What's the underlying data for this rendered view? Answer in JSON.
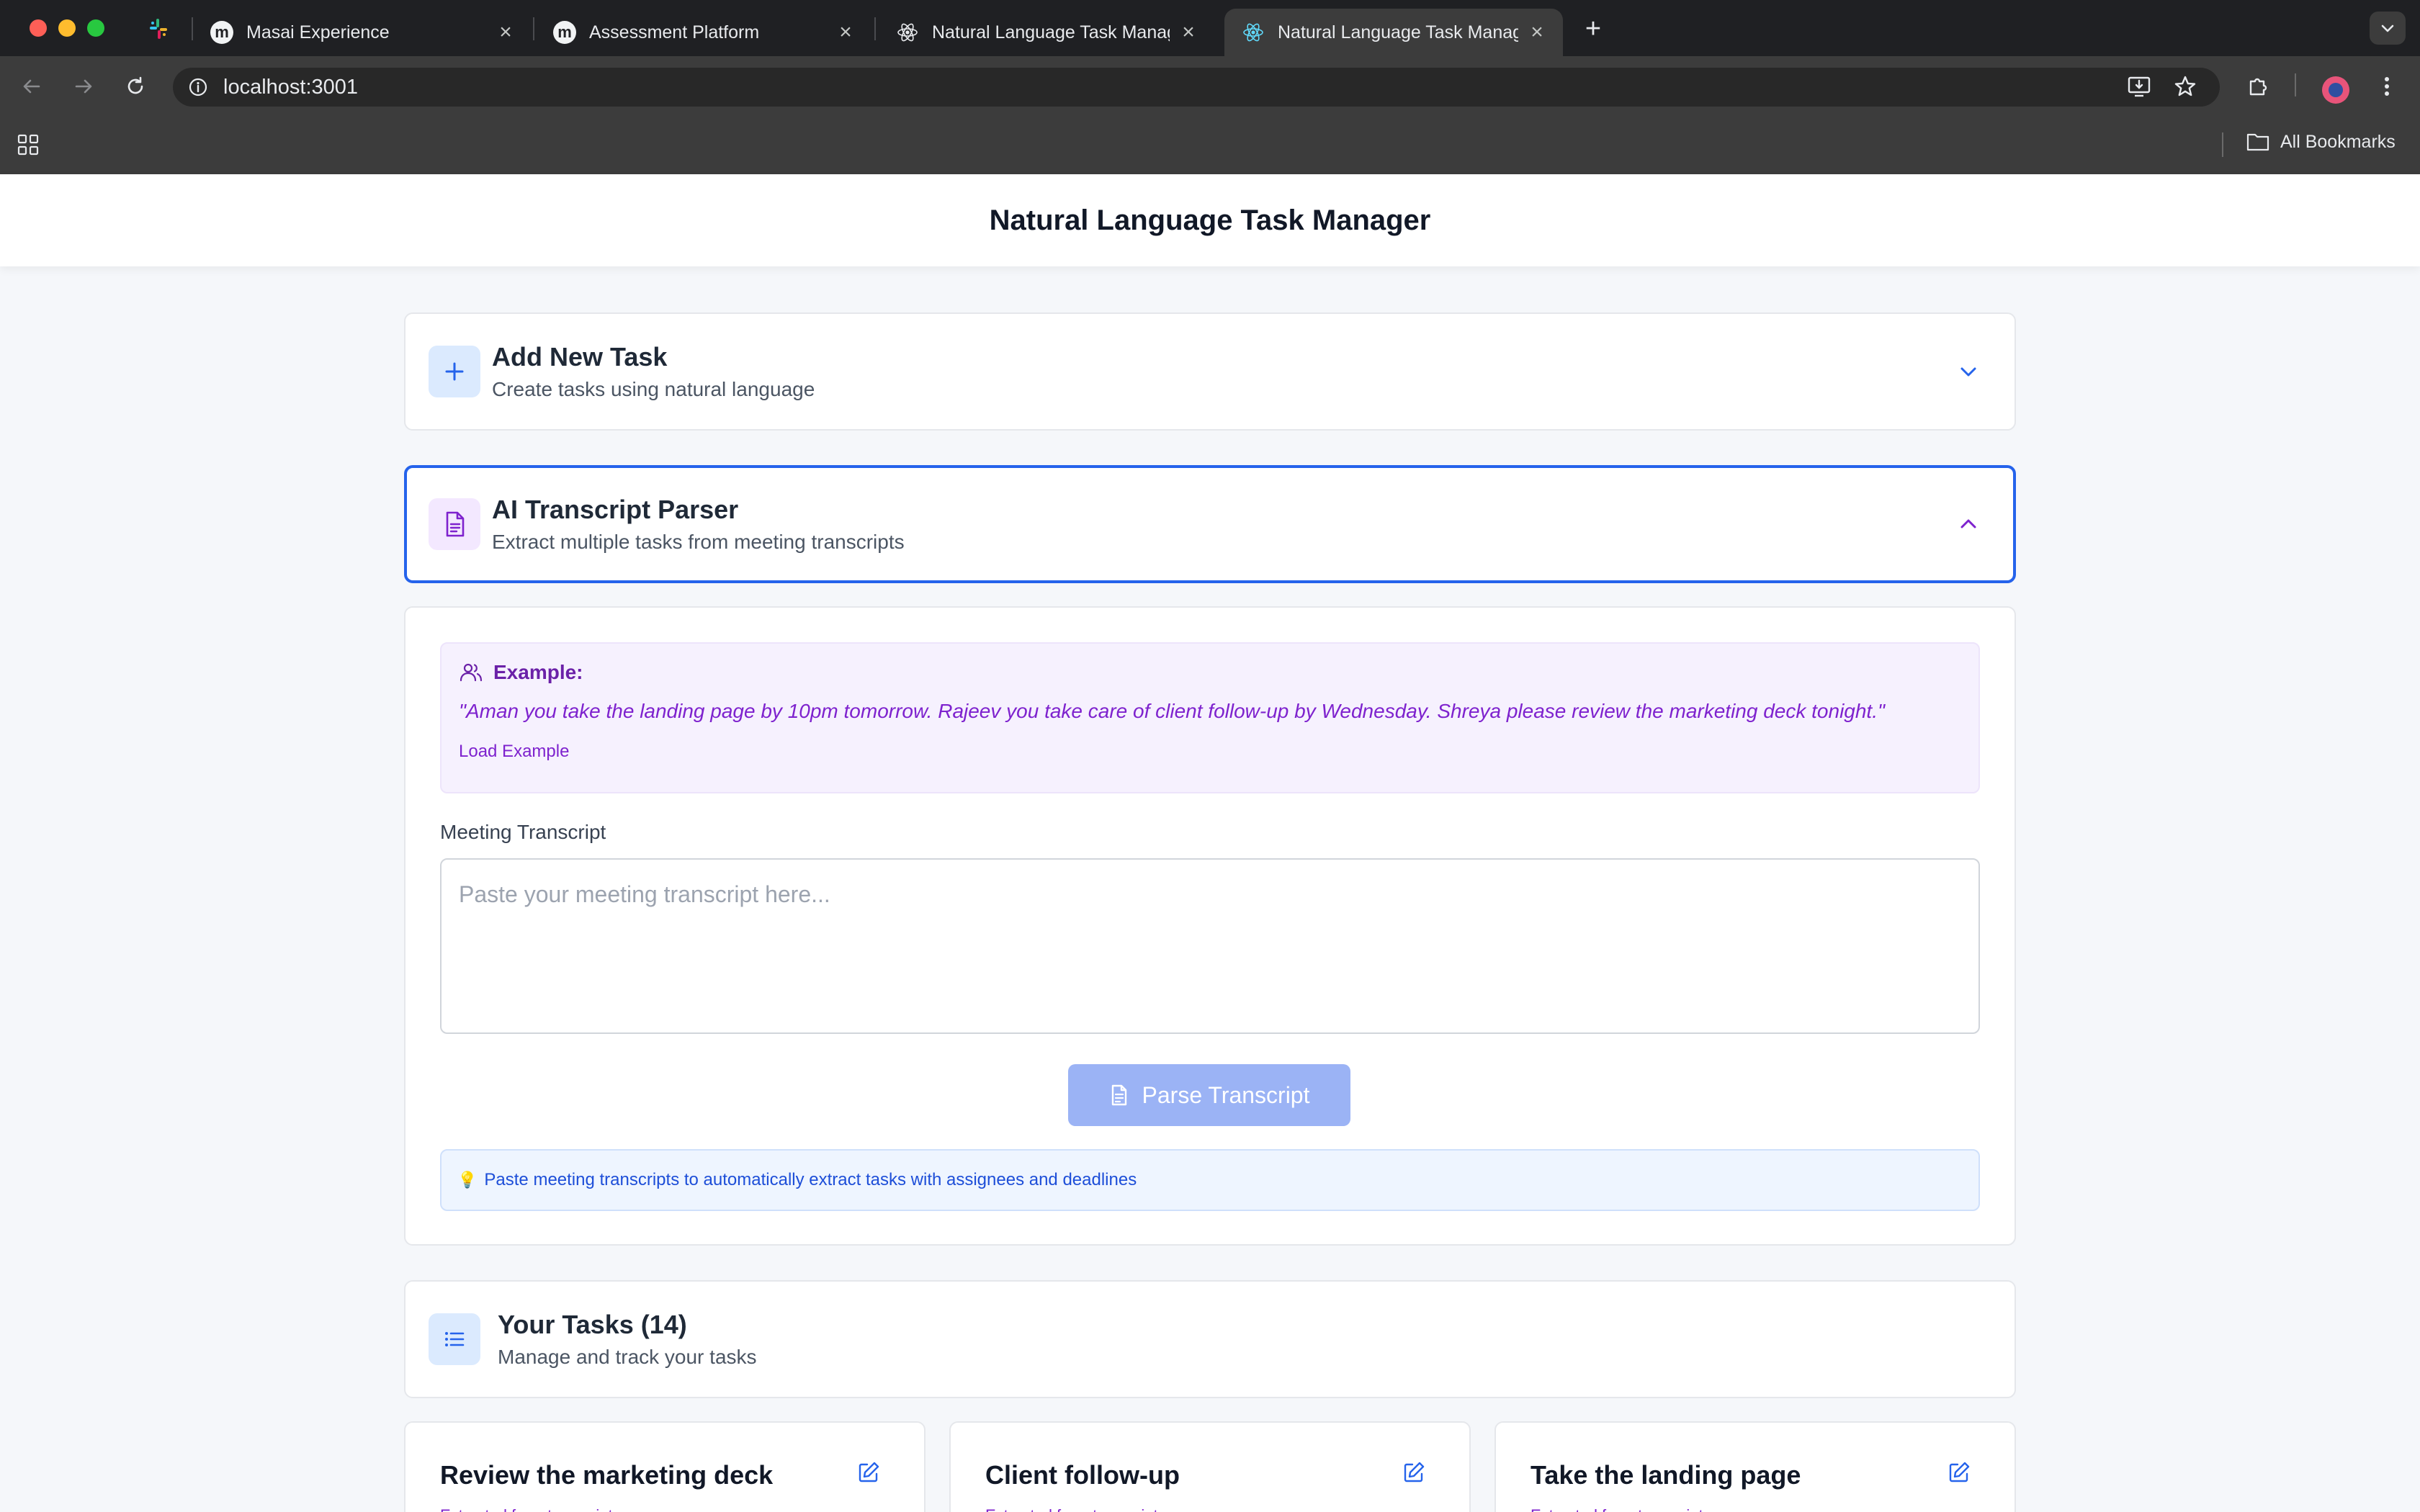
{
  "browser": {
    "tabs": [
      {
        "label": "Masai Experience",
        "icon": "masai-icon"
      },
      {
        "label": "Assessment Platform",
        "icon": "masai-icon"
      },
      {
        "label": "Natural Language Task Manag",
        "icon": "react-icon"
      },
      {
        "label": "Natural Language Task Manag",
        "icon": "react-icon",
        "active": true
      }
    ],
    "favicon_letter": "m",
    "url": "localhost:3001",
    "bookmarks_label": "All Bookmarks"
  },
  "app": {
    "title": "Natural Language Task Manager"
  },
  "add_task": {
    "title": "Add New Task",
    "subtitle": "Create tasks using natural language"
  },
  "parser": {
    "title": "AI Transcript Parser",
    "subtitle": "Extract multiple tasks from meeting transcripts",
    "example_label": "Example:",
    "example_text": "\"Aman you take the landing page by 10pm tomorrow. Rajeev you take care of client follow-up by Wednesday. Shreya please review the marketing deck tonight.\"",
    "load_example": "Load Example",
    "field_label": "Meeting Transcript",
    "placeholder": "Paste your meeting transcript here...",
    "parse_button": "Parse Transcript",
    "tip": "Paste meeting transcripts to automatically extract tasks with assignees and deadlines",
    "tip_icon": "💡"
  },
  "tasks": {
    "title": "Your Tasks (14)",
    "subtitle": "Manage and track your tasks",
    "items": [
      {
        "title": "Review the marketing deck",
        "meta": "Extracted from transcript"
      },
      {
        "title": "Client follow-up",
        "meta": "Extracted from transcript"
      },
      {
        "title": "Take the landing page",
        "meta": "Extracted from transcript"
      }
    ]
  },
  "colors": {
    "accent_blue": "#2563eb",
    "accent_purple": "#7e22ce",
    "parse_button_disabled": "#9bb3f5"
  }
}
